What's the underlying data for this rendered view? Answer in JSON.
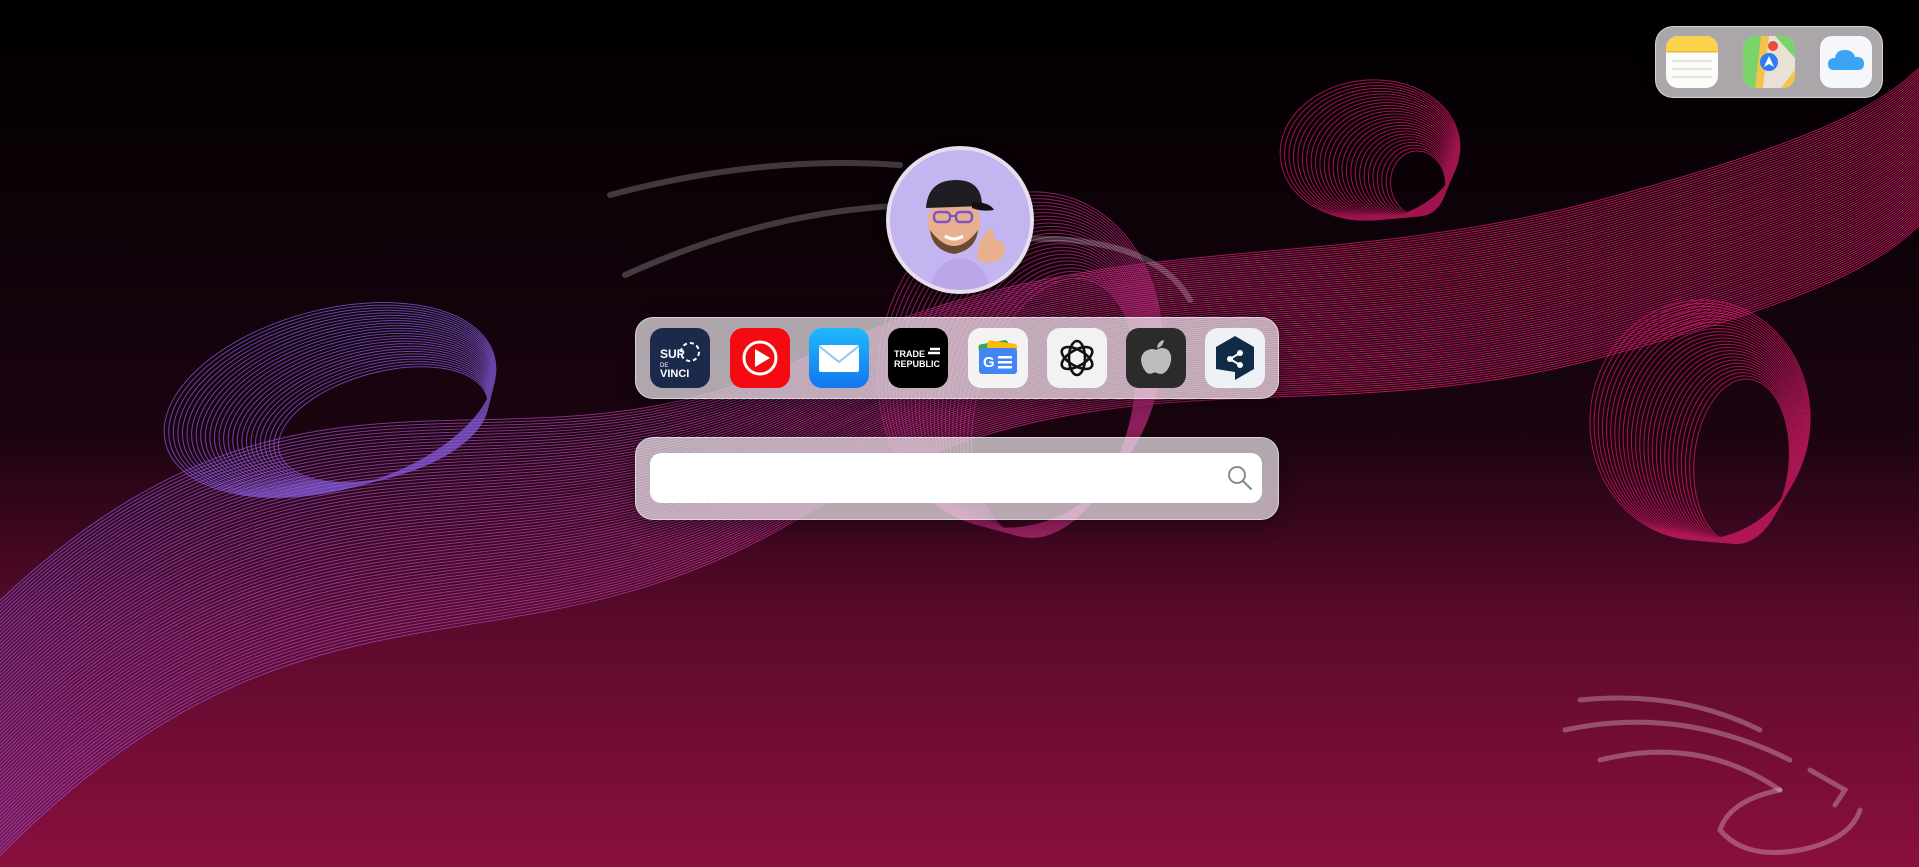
{
  "top_dock": {
    "apps": [
      {
        "name": "Notes",
        "icon": "notes-icon"
      },
      {
        "name": "Maps",
        "icon": "maps-icon"
      },
      {
        "name": "iCloud",
        "icon": "icloud-icon"
      }
    ]
  },
  "avatar": {
    "icon": "memoji-avatar-icon"
  },
  "app_dock": {
    "apps": [
      {
        "name": "Sup de Vinci",
        "icon": "supdevinci-icon"
      },
      {
        "name": "YouTube",
        "icon": "youtube-icon"
      },
      {
        "name": "Mail",
        "icon": "mail-icon"
      },
      {
        "name": "Trade Republic",
        "icon": "traderepublic-icon"
      },
      {
        "name": "Google News",
        "icon": "google-news-icon"
      },
      {
        "name": "ChatGPT",
        "icon": "openai-icon"
      },
      {
        "name": "Apple",
        "icon": "apple-icon"
      },
      {
        "name": "Deepl",
        "icon": "deepl-icon"
      }
    ],
    "labels": {
      "supdevinci_line1": "SUP",
      "supdevinci_line2": "DE",
      "supdevinci_line3": "VINCI",
      "traderepublic_line1": "TRADE",
      "traderepublic_line2": "REPUBLIC",
      "google_news_letter": "G"
    }
  },
  "search": {
    "value": "",
    "placeholder": ""
  },
  "colors": {
    "background_top": "#000000",
    "background_bottom": "#8a0f3f",
    "wave_pink": "#e0206e",
    "wave_purple": "#8c5ce0",
    "glass": "#ebe6eb"
  }
}
